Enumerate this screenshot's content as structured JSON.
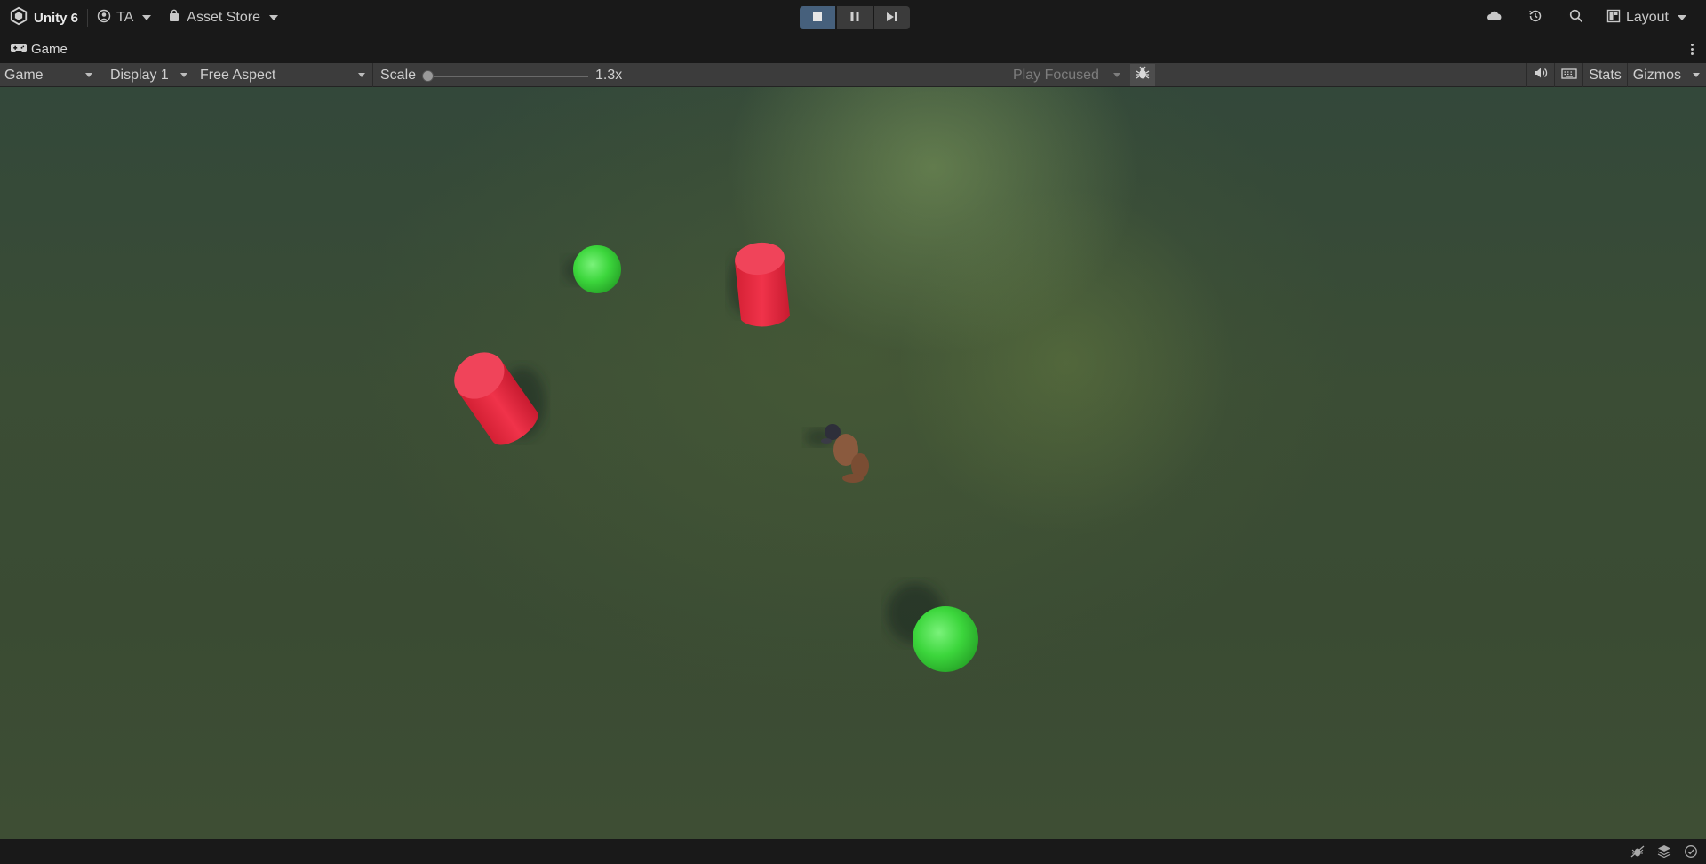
{
  "app": {
    "title": "Unity 6",
    "account_label": "TA",
    "asset_store_label": "Asset Store",
    "layout_label": "Layout"
  },
  "tab": {
    "label": "Game"
  },
  "game_toolbar": {
    "view_mode": "Game",
    "display": "Display 1",
    "aspect": "Free Aspect",
    "scale_label": "Scale",
    "scale_value": "1.3x",
    "play_mode": "Play Focused",
    "stats_label": "Stats",
    "gizmos_label": "Gizmos"
  },
  "colors": {
    "accent_active": "#46607c",
    "pickup_green": "#3cd63c",
    "obstacle_red": "#e8283e"
  },
  "icons": {
    "brand": "unity-logo-icon",
    "account": "account-icon",
    "asset_store": "shopping-bag-icon",
    "cloud": "cloud-icon",
    "history": "history-icon",
    "search": "search-icon",
    "layout": "layout-icon",
    "stop": "stop-icon",
    "pause": "pause-icon",
    "step": "step-icon",
    "game_tab": "gamepad-icon",
    "bug": "bug-icon",
    "audio": "speaker-icon",
    "shortcuts": "keyboard-icon"
  }
}
